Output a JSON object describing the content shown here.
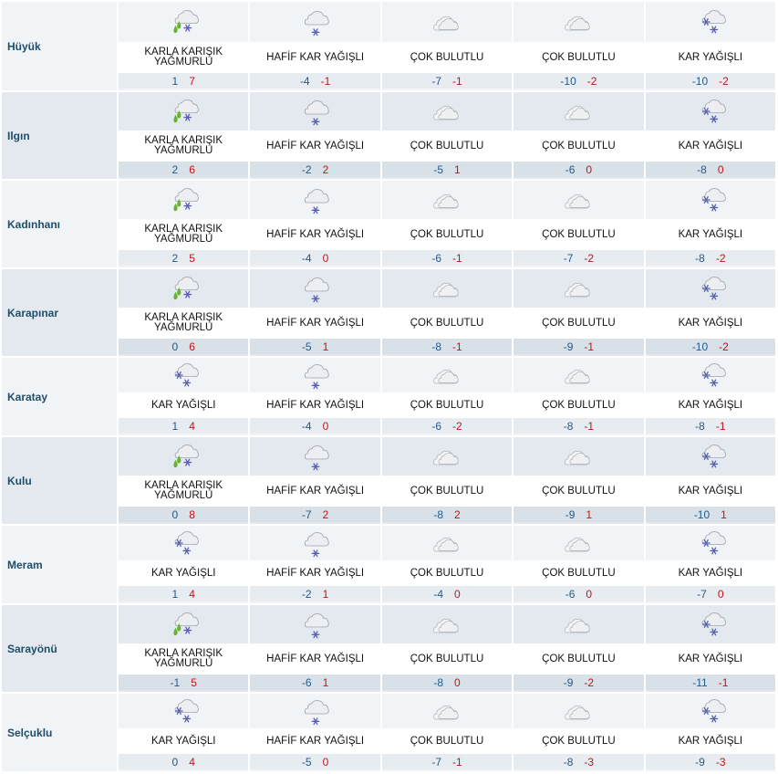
{
  "colors": {
    "row_bg_light": "#f1f4f7",
    "row_bg_dark": "#e3e9ef",
    "temp_band_light": "#e7ecf1",
    "temp_band_dark": "#d9e1e8",
    "city_text": "#1f4e6b",
    "temp_min": "#235a8c",
    "temp_max": "#c0141c"
  },
  "cities": [
    {
      "name": "Hüyük",
      "days": [
        {
          "condition": "KARLA KARIŞIK YAĞMURLU",
          "icon": "sleet-icon",
          "min": "1",
          "max": "7"
        },
        {
          "condition": "HAFİF KAR YAĞIŞLI",
          "icon": "light-snow-icon",
          "min": "-4",
          "max": "-1"
        },
        {
          "condition": "ÇOK BULUTLU",
          "icon": "cloudy-icon",
          "min": "-7",
          "max": "-1"
        },
        {
          "condition": "ÇOK BULUTLU",
          "icon": "cloudy-icon",
          "min": "-10",
          "max": "-2"
        },
        {
          "condition": "KAR YAĞIŞLI",
          "icon": "snow-icon",
          "min": "-10",
          "max": "-2"
        }
      ]
    },
    {
      "name": "Ilgın",
      "days": [
        {
          "condition": "KARLA KARIŞIK YAĞMURLU",
          "icon": "sleet-icon",
          "min": "2",
          "max": "6"
        },
        {
          "condition": "HAFİF KAR YAĞIŞLI",
          "icon": "light-snow-icon",
          "min": "-2",
          "max": "2"
        },
        {
          "condition": "ÇOK BULUTLU",
          "icon": "cloudy-icon",
          "min": "-5",
          "max": "1"
        },
        {
          "condition": "ÇOK BULUTLU",
          "icon": "cloudy-icon",
          "min": "-6",
          "max": "0"
        },
        {
          "condition": "KAR YAĞIŞLI",
          "icon": "snow-icon",
          "min": "-8",
          "max": "0"
        }
      ]
    },
    {
      "name": "Kadınhanı",
      "days": [
        {
          "condition": "KARLA KARIŞIK YAĞMURLU",
          "icon": "sleet-icon",
          "min": "2",
          "max": "5"
        },
        {
          "condition": "HAFİF KAR YAĞIŞLI",
          "icon": "light-snow-icon",
          "min": "-4",
          "max": "0"
        },
        {
          "condition": "ÇOK BULUTLU",
          "icon": "cloudy-icon",
          "min": "-6",
          "max": "-1"
        },
        {
          "condition": "ÇOK BULUTLU",
          "icon": "cloudy-icon",
          "min": "-7",
          "max": "-2"
        },
        {
          "condition": "KAR YAĞIŞLI",
          "icon": "snow-icon",
          "min": "-8",
          "max": "-2"
        }
      ]
    },
    {
      "name": "Karapınar",
      "days": [
        {
          "condition": "KARLA KARIŞIK YAĞMURLU",
          "icon": "sleet-icon",
          "min": "0",
          "max": "6"
        },
        {
          "condition": "HAFİF KAR YAĞIŞLI",
          "icon": "light-snow-icon",
          "min": "-5",
          "max": "1"
        },
        {
          "condition": "ÇOK BULUTLU",
          "icon": "cloudy-icon",
          "min": "-8",
          "max": "-1"
        },
        {
          "condition": "ÇOK BULUTLU",
          "icon": "cloudy-icon",
          "min": "-9",
          "max": "-1"
        },
        {
          "condition": "KAR YAĞIŞLI",
          "icon": "snow-icon",
          "min": "-10",
          "max": "-2"
        }
      ]
    },
    {
      "name": "Karatay",
      "days": [
        {
          "condition": "KAR YAĞIŞLI",
          "icon": "snow-icon",
          "min": "1",
          "max": "4"
        },
        {
          "condition": "HAFİF KAR YAĞIŞLI",
          "icon": "light-snow-icon",
          "min": "-4",
          "max": "0"
        },
        {
          "condition": "ÇOK BULUTLU",
          "icon": "cloudy-icon",
          "min": "-6",
          "max": "-2"
        },
        {
          "condition": "ÇOK BULUTLU",
          "icon": "cloudy-icon",
          "min": "-8",
          "max": "-1"
        },
        {
          "condition": "KAR YAĞIŞLI",
          "icon": "snow-icon",
          "min": "-8",
          "max": "-1"
        }
      ]
    },
    {
      "name": "Kulu",
      "days": [
        {
          "condition": "KARLA KARIŞIK YAĞMURLU",
          "icon": "sleet-icon",
          "min": "0",
          "max": "8"
        },
        {
          "condition": "HAFİF KAR YAĞIŞLI",
          "icon": "light-snow-icon",
          "min": "-7",
          "max": "2"
        },
        {
          "condition": "ÇOK BULUTLU",
          "icon": "cloudy-icon",
          "min": "-8",
          "max": "2"
        },
        {
          "condition": "ÇOK BULUTLU",
          "icon": "cloudy-icon",
          "min": "-9",
          "max": "1"
        },
        {
          "condition": "KAR YAĞIŞLI",
          "icon": "snow-icon",
          "min": "-10",
          "max": "1"
        }
      ]
    },
    {
      "name": "Meram",
      "days": [
        {
          "condition": "KAR YAĞIŞLI",
          "icon": "snow-icon",
          "min": "1",
          "max": "4"
        },
        {
          "condition": "HAFİF KAR YAĞIŞLI",
          "icon": "light-snow-icon",
          "min": "-2",
          "max": "1"
        },
        {
          "condition": "ÇOK BULUTLU",
          "icon": "cloudy-icon",
          "min": "-4",
          "max": "0"
        },
        {
          "condition": "ÇOK BULUTLU",
          "icon": "cloudy-icon",
          "min": "-6",
          "max": "0"
        },
        {
          "condition": "KAR YAĞIŞLI",
          "icon": "snow-icon",
          "min": "-7",
          "max": "0"
        }
      ]
    },
    {
      "name": "Sarayönü",
      "days": [
        {
          "condition": "KARLA KARIŞIK YAĞMURLU",
          "icon": "sleet-icon",
          "min": "-1",
          "max": "5"
        },
        {
          "condition": "HAFİF KAR YAĞIŞLI",
          "icon": "light-snow-icon",
          "min": "-6",
          "max": "1"
        },
        {
          "condition": "ÇOK BULUTLU",
          "icon": "cloudy-icon",
          "min": "-8",
          "max": "0"
        },
        {
          "condition": "ÇOK BULUTLU",
          "icon": "cloudy-icon",
          "min": "-9",
          "max": "-2"
        },
        {
          "condition": "KAR YAĞIŞLI",
          "icon": "snow-icon",
          "min": "-11",
          "max": "-1"
        }
      ]
    },
    {
      "name": "Selçuklu",
      "days": [
        {
          "condition": "KAR YAĞIŞLI",
          "icon": "snow-icon",
          "min": "0",
          "max": "4"
        },
        {
          "condition": "HAFİF KAR YAĞIŞLI",
          "icon": "light-snow-icon",
          "min": "-5",
          "max": "0"
        },
        {
          "condition": "ÇOK BULUTLU",
          "icon": "cloudy-icon",
          "min": "-7",
          "max": "-1"
        },
        {
          "condition": "ÇOK BULUTLU",
          "icon": "cloudy-icon",
          "min": "-8",
          "max": "-3"
        },
        {
          "condition": "KAR YAĞIŞLI",
          "icon": "snow-icon",
          "min": "-9",
          "max": "-3"
        }
      ]
    }
  ]
}
